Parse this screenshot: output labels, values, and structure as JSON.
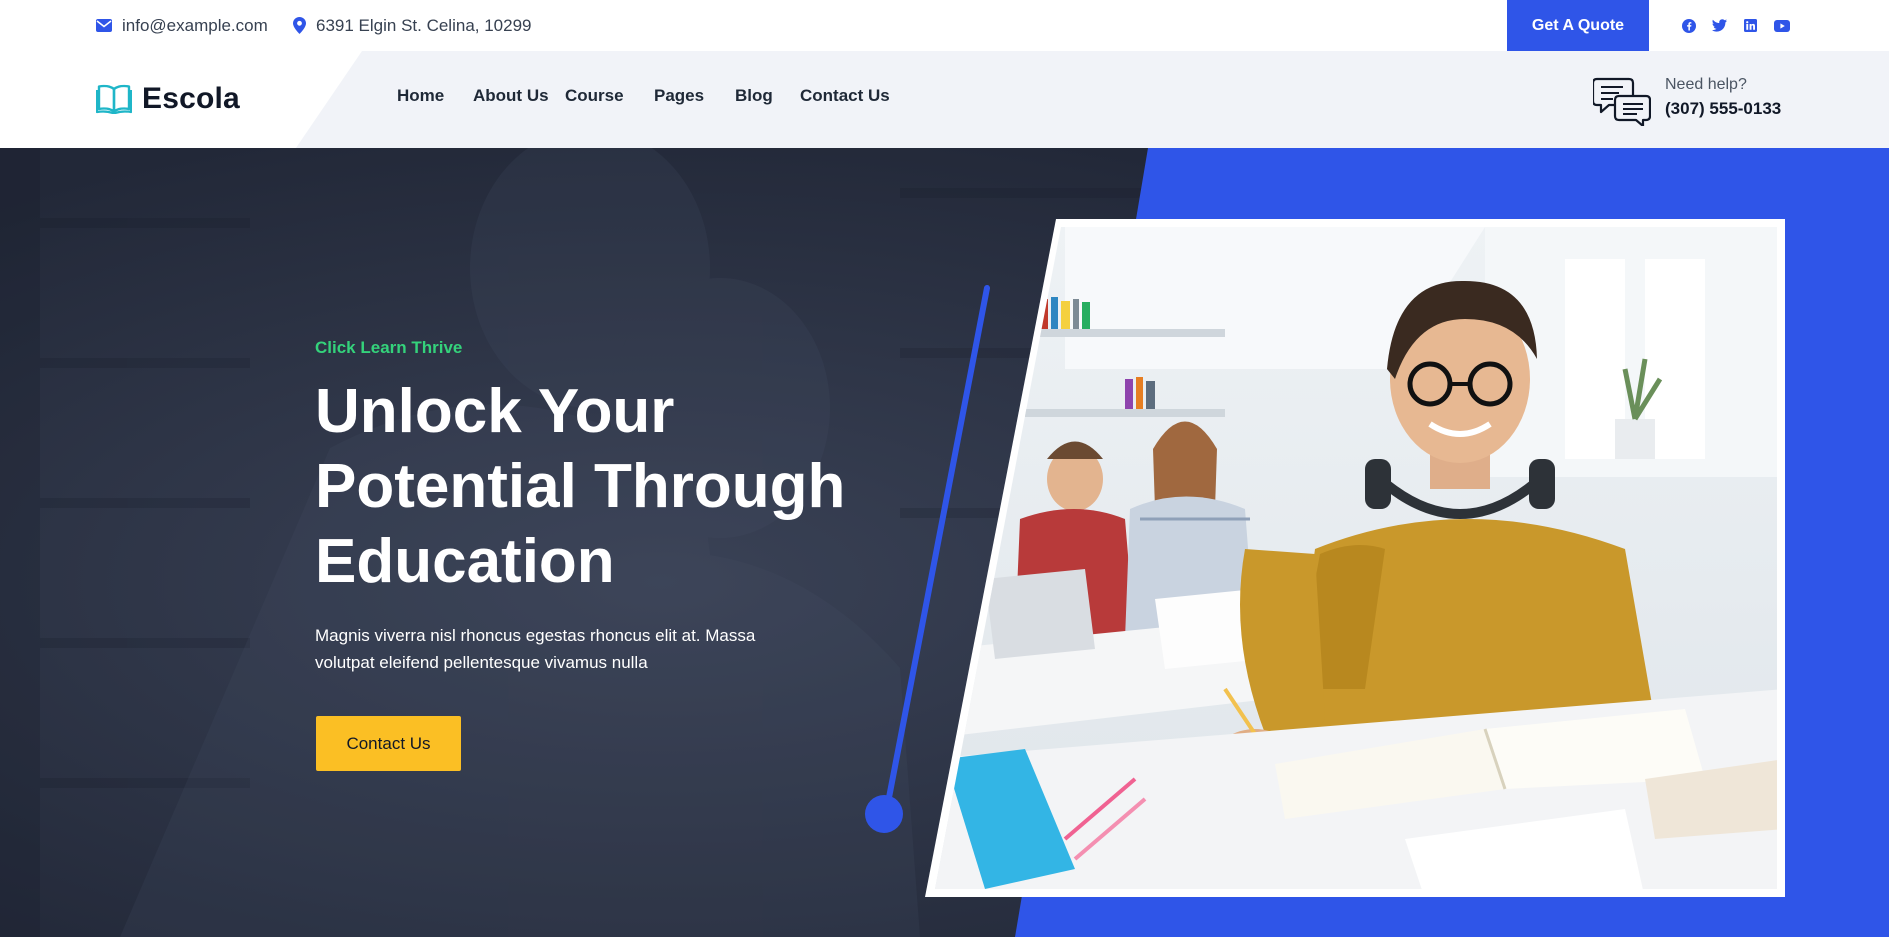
{
  "topbar": {
    "email": "info@example.com",
    "address": "6391 Elgin St. Celina, 10299",
    "quote_button": "Get A Quote",
    "socials": [
      {
        "icon": "facebook-icon"
      },
      {
        "icon": "twitter-icon"
      },
      {
        "icon": "linkedin-icon"
      },
      {
        "icon": "youtube-icon"
      }
    ]
  },
  "header": {
    "logo_text": "Escola",
    "nav": [
      "Home",
      "About Us",
      "Course",
      "Pages",
      "Blog",
      "Contact Us"
    ],
    "help_label": "Need help?",
    "help_phone": "(307) 555-0133"
  },
  "hero": {
    "eyebrow": "Click Learn Thrive",
    "headline": [
      "Unlock Your",
      "Potential Through",
      "Education"
    ],
    "description": "Magnis viverra nisl rhoncus egestas rhoncus elit at. Massa volutpat eleifend pellentesque vivamus nulla",
    "cta": "Contact Us"
  },
  "colors": {
    "brand_blue": "#2f55e8",
    "accent_green": "#34d27b",
    "cta_yellow": "#fbbf24",
    "hero_dark": "#252b3d",
    "logo_teal": "#1fb6c8"
  }
}
